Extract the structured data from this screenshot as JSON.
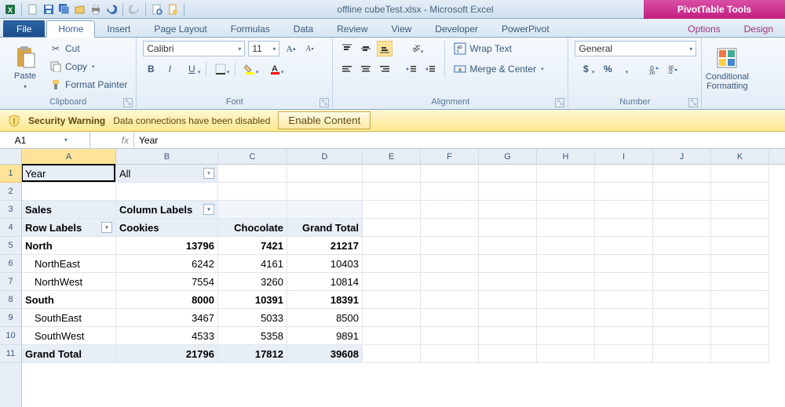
{
  "title": "offline cubeTest.xlsx  -  Microsoft Excel",
  "pivot_tools": "PivotTable Tools",
  "tabs": {
    "file": "File",
    "home": "Home",
    "insert": "Insert",
    "page_layout": "Page Layout",
    "formulas": "Formulas",
    "data": "Data",
    "review": "Review",
    "view": "View",
    "developer": "Developer",
    "powerpivot": "PowerPivot",
    "options": "Options",
    "design": "Design"
  },
  "ribbon": {
    "paste": "Paste",
    "cut": "Cut",
    "copy": "Copy",
    "format_painter": "Format Painter",
    "clipboard": "Clipboard",
    "font_name": "Calibri",
    "font_size": "11",
    "font": "Font",
    "alignment": "Alignment",
    "wrap_text": "Wrap Text",
    "merge_center": "Merge & Center",
    "number": "Number",
    "number_format": "General",
    "conditional_formatting": "Conditional\nFormatting"
  },
  "security": {
    "title": "Security Warning",
    "msg": "Data connections have been disabled",
    "btn": "Enable Content"
  },
  "namebox": "A1",
  "formula": "Year",
  "columns": [
    "A",
    "B",
    "C",
    "D",
    "E",
    "F",
    "G",
    "H",
    "I",
    "J",
    "K"
  ],
  "rows": [
    "1",
    "2",
    "3",
    "4",
    "5",
    "6",
    "7",
    "8",
    "9",
    "10",
    "11"
  ],
  "pivot": {
    "filter_field": "Year",
    "filter_value": "All",
    "measure": "Sales",
    "col_label": "Column Labels",
    "row_label": "Row Labels",
    "cols": [
      "Cookies",
      "Chocolate",
      "Grand Total"
    ],
    "data": [
      {
        "label": "North",
        "vals": [
          "13796",
          "7421",
          "21217"
        ],
        "bold": true,
        "indent": false
      },
      {
        "label": "NorthEast",
        "vals": [
          "6242",
          "4161",
          "10403"
        ],
        "bold": false,
        "indent": true
      },
      {
        "label": "NorthWest",
        "vals": [
          "7554",
          "3260",
          "10814"
        ],
        "bold": false,
        "indent": true
      },
      {
        "label": "South",
        "vals": [
          "8000",
          "10391",
          "18391"
        ],
        "bold": true,
        "indent": false
      },
      {
        "label": "SouthEast",
        "vals": [
          "3467",
          "5033",
          "8500"
        ],
        "bold": false,
        "indent": true
      },
      {
        "label": "SouthWest",
        "vals": [
          "4533",
          "5358",
          "9891"
        ],
        "bold": false,
        "indent": true
      },
      {
        "label": "Grand Total",
        "vals": [
          "21796",
          "17812",
          "39608"
        ],
        "bold": true,
        "indent": false
      }
    ]
  }
}
